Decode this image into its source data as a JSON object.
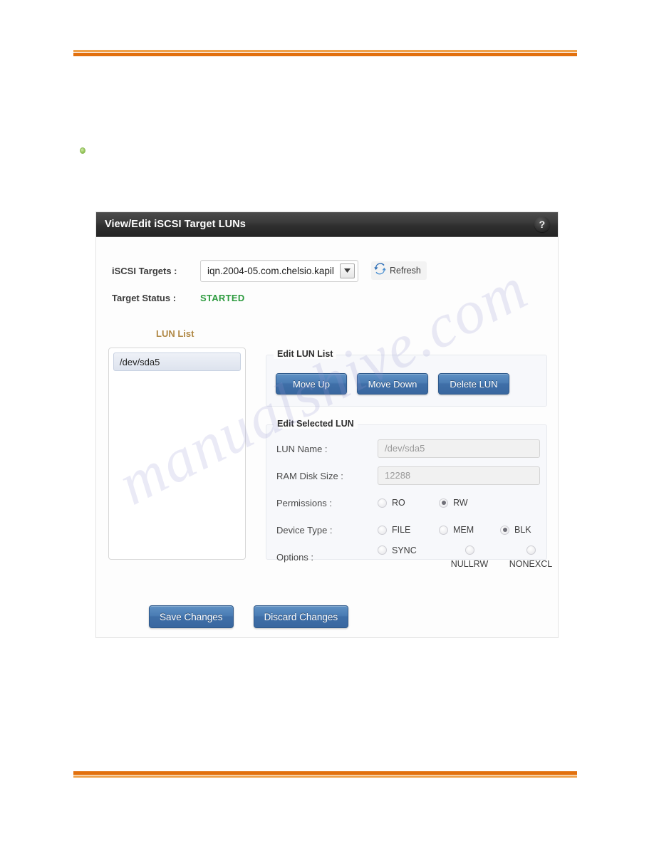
{
  "page": {
    "watermark_text": "manualshive.com",
    "rule_color_light": "#efa14a",
    "rule_color_dark": "#e2700d",
    "bullet_color": "#9ccc62"
  },
  "panel": {
    "title": "View/Edit iSCSI Target LUNs",
    "help_label": "?",
    "targets": {
      "label": "iSCSI Targets :",
      "selected_value": "iqn.2004-05.com.chelsio.kapil",
      "options": [
        "iqn.2004-05.com.chelsio.kapil"
      ],
      "refresh_label": "Refresh",
      "refresh_icon": "refresh-icon"
    },
    "status": {
      "label": "Target Status :",
      "value": "STARTED",
      "value_color": "#2d9b3f"
    },
    "lun_list": {
      "title": "LUN List",
      "title_color": "#b08845",
      "items": [
        "/dev/sda5"
      ],
      "selected_index": 0
    },
    "edit_lun_list": {
      "legend": "Edit LUN List",
      "buttons": [
        {
          "label": "Move Up",
          "name": "move-up-button"
        },
        {
          "label": "Move Down",
          "name": "move-down-button"
        },
        {
          "label": "Delete LUN",
          "name": "delete-lun-button"
        }
      ]
    },
    "edit_selected_lun": {
      "legend": "Edit Selected LUN",
      "lun_name": {
        "label": "LUN Name :",
        "value": "/dev/sda5"
      },
      "ram_disk_size": {
        "label": "RAM Disk Size :",
        "value": "12288"
      },
      "permissions": {
        "label": "Permissions :",
        "options": [
          {
            "label": "RO",
            "checked": false
          },
          {
            "label": "RW",
            "checked": true
          }
        ]
      },
      "device_type": {
        "label": "Device Type :",
        "options": [
          {
            "label": "FILE",
            "checked": false
          },
          {
            "label": "MEM",
            "checked": false
          },
          {
            "label": "BLK",
            "checked": true
          }
        ]
      },
      "options_row": {
        "label": "Options :",
        "options": [
          {
            "label": "SYNC",
            "checked": false
          },
          {
            "label": "NULLRW",
            "checked": false
          },
          {
            "label": "NONEXCL",
            "checked": false
          }
        ]
      }
    },
    "footer": {
      "save_label": "Save Changes",
      "discard_label": "Discard Changes"
    }
  }
}
